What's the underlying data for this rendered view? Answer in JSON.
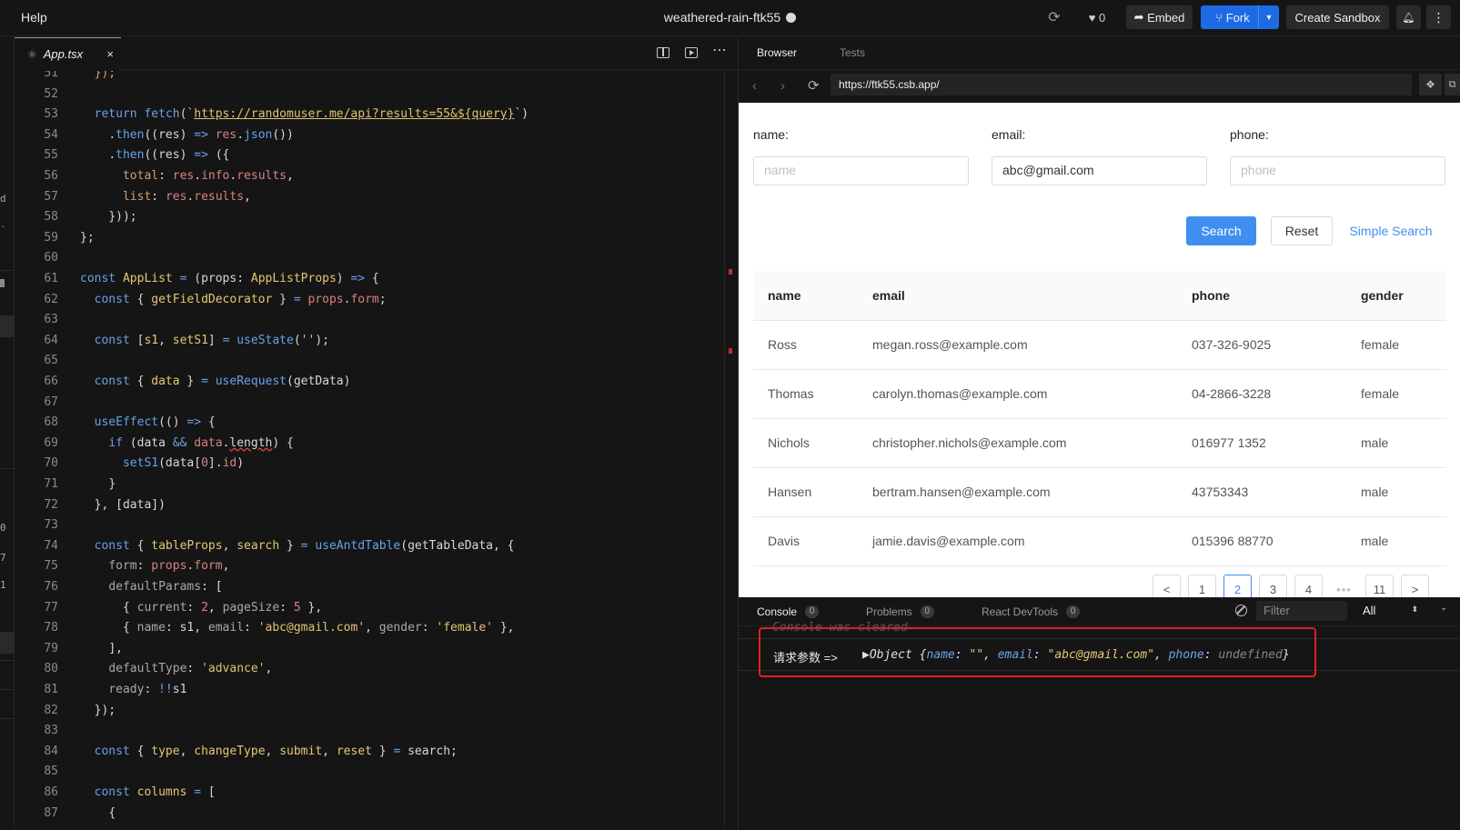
{
  "topbar": {
    "help": "Help",
    "title": "weathered-rain-ftk55",
    "likes": "0",
    "embed": "Embed",
    "fork": "Fork",
    "create_sandbox": "Create Sandbox"
  },
  "left_strip": {
    "fragments": [
      "d",
      "0",
      "7",
      "1"
    ]
  },
  "editor": {
    "tab_name": "App.tsx",
    "close": "×"
  },
  "code_lines": [
    {
      "n": "51",
      "i": 1,
      "t": [
        [
          "p",
          "});"
        ]
      ]
    },
    {
      "n": "52",
      "i": 0,
      "t": []
    },
    {
      "n": "53",
      "i": 1,
      "t": [
        [
          "k",
          "return "
        ],
        [
          "f",
          "fetch"
        ],
        [
          "",
          "("
        ],
        [
          "s",
          "`"
        ],
        [
          "ul",
          "https://randomuser.me/api?results=55&${query}"
        ],
        [
          "s",
          "`"
        ],
        [
          "",
          ")"
        ]
      ]
    },
    {
      "n": "54",
      "i": 2,
      "t": [
        [
          "",
          "."
        ],
        [
          "f",
          "then"
        ],
        [
          "",
          "(("
        ],
        [
          "",
          "res"
        ],
        [
          "",
          ") "
        ],
        [
          "o",
          "=>"
        ],
        [
          "",
          " "
        ],
        [
          "v",
          "res"
        ],
        [
          "",
          "."
        ],
        [
          "f",
          "json"
        ],
        [
          "",
          "())"
        ]
      ]
    },
    {
      "n": "55",
      "i": 2,
      "t": [
        [
          "",
          "."
        ],
        [
          "f",
          "then"
        ],
        [
          "",
          "(("
        ],
        [
          "",
          "res"
        ],
        [
          "",
          ") "
        ],
        [
          "o",
          "=>"
        ],
        [
          "",
          " ({"
        ]
      ]
    },
    {
      "n": "56",
      "i": 3,
      "t": [
        [
          "p",
          "total"
        ],
        [
          "",
          ": "
        ],
        [
          "v",
          "res"
        ],
        [
          "",
          "."
        ],
        [
          "v",
          "info"
        ],
        [
          "",
          "."
        ],
        [
          "v",
          "results"
        ],
        [
          "",
          ","
        ]
      ]
    },
    {
      "n": "57",
      "i": 3,
      "t": [
        [
          "p",
          "list"
        ],
        [
          "",
          ": "
        ],
        [
          "v",
          "res"
        ],
        [
          "",
          "."
        ],
        [
          "v",
          "results"
        ],
        [
          "",
          ","
        ]
      ]
    },
    {
      "n": "58",
      "i": 2,
      "t": [
        [
          "",
          "}));"
        ]
      ]
    },
    {
      "n": "59",
      "i": 0,
      "t": [
        [
          "",
          "};"
        ]
      ]
    },
    {
      "n": "60",
      "i": 0,
      "t": []
    },
    {
      "n": "61",
      "i": 0,
      "t": [
        [
          "k",
          "const "
        ],
        [
          "t",
          "AppList"
        ],
        [
          "o",
          " = "
        ],
        [
          "",
          "("
        ],
        [
          "",
          "props"
        ],
        [
          "",
          ": "
        ],
        [
          "t",
          "AppListProps"
        ],
        [
          "",
          ") "
        ],
        [
          "o",
          "=>"
        ],
        [
          "",
          " {"
        ]
      ]
    },
    {
      "n": "62",
      "i": 1,
      "t": [
        [
          "k",
          "const "
        ],
        [
          "",
          "{ "
        ],
        [
          "t",
          "getFieldDecorator"
        ],
        [
          "",
          " } "
        ],
        [
          "o",
          "="
        ],
        [
          "",
          " "
        ],
        [
          "v",
          "props"
        ],
        [
          "",
          "."
        ],
        [
          "v",
          "form"
        ],
        [
          "",
          ";"
        ]
      ]
    },
    {
      "n": "63",
      "i": 0,
      "t": []
    },
    {
      "n": "64",
      "i": 1,
      "t": [
        [
          "k",
          "const "
        ],
        [
          "",
          "["
        ],
        [
          "t",
          "s1"
        ],
        [
          "",
          ", "
        ],
        [
          "t",
          "setS1"
        ],
        [
          "",
          "] "
        ],
        [
          "o",
          "="
        ],
        [
          "",
          " "
        ],
        [
          "f",
          "useState"
        ],
        [
          "",
          "("
        ],
        [
          "s",
          "''"
        ],
        [
          "",
          ");"
        ]
      ]
    },
    {
      "n": "65",
      "i": 0,
      "t": []
    },
    {
      "n": "66",
      "i": 1,
      "t": [
        [
          "k",
          "const "
        ],
        [
          "",
          "{ "
        ],
        [
          "t",
          "data"
        ],
        [
          "",
          " } "
        ],
        [
          "o",
          "="
        ],
        [
          "",
          " "
        ],
        [
          "f",
          "useRequest"
        ],
        [
          "",
          "(getData)"
        ]
      ]
    },
    {
      "n": "67",
      "i": 0,
      "t": []
    },
    {
      "n": "68",
      "i": 1,
      "t": [
        [
          "f",
          "useEffect"
        ],
        [
          "",
          "(() "
        ],
        [
          "o",
          "=>"
        ],
        [
          "",
          " {"
        ]
      ]
    },
    {
      "n": "69",
      "i": 2,
      "t": [
        [
          "k",
          "if "
        ],
        [
          "",
          "(data "
        ],
        [
          "o",
          "&&"
        ],
        [
          "",
          " "
        ],
        [
          "v",
          "data"
        ],
        [
          "",
          "."
        ],
        [
          "sq",
          "length"
        ],
        [
          "",
          ") {"
        ]
      ]
    },
    {
      "n": "70",
      "i": 3,
      "t": [
        [
          "f",
          "setS1"
        ],
        [
          "",
          "(data["
        ],
        [
          "v",
          "0"
        ],
        [
          "",
          "]."
        ],
        [
          "v",
          "id"
        ],
        [
          "",
          ")"
        ]
      ]
    },
    {
      "n": "71",
      "i": 2,
      "t": [
        [
          "",
          "}"
        ]
      ]
    },
    {
      "n": "72",
      "i": 1,
      "t": [
        [
          "",
          "}, [data])"
        ]
      ]
    },
    {
      "n": "73",
      "i": 0,
      "t": []
    },
    {
      "n": "74",
      "i": 1,
      "t": [
        [
          "k",
          "const "
        ],
        [
          "",
          "{ "
        ],
        [
          "t",
          "tableProps"
        ],
        [
          "",
          ", "
        ],
        [
          "t",
          "search"
        ],
        [
          "",
          " } "
        ],
        [
          "o",
          "="
        ],
        [
          "",
          " "
        ],
        [
          "f",
          "useAntdTable"
        ],
        [
          "",
          "(getTableData, {"
        ]
      ]
    },
    {
      "n": "75",
      "i": 2,
      "t": [
        [
          "dim",
          "form"
        ],
        [
          "",
          ": "
        ],
        [
          "v",
          "props"
        ],
        [
          "",
          "."
        ],
        [
          "v",
          "form"
        ],
        [
          "",
          ","
        ]
      ]
    },
    {
      "n": "76",
      "i": 2,
      "t": [
        [
          "dim",
          "defaultParams"
        ],
        [
          "",
          ": ["
        ]
      ]
    },
    {
      "n": "77",
      "i": 3,
      "t": [
        [
          "",
          "{ "
        ],
        [
          "dim",
          "current"
        ],
        [
          "",
          ": "
        ],
        [
          "v",
          "2"
        ],
        [
          "",
          ", "
        ],
        [
          "dim",
          "pageSize"
        ],
        [
          "",
          ": "
        ],
        [
          "v",
          "5"
        ],
        [
          "",
          " },"
        ]
      ]
    },
    {
      "n": "78",
      "i": 3,
      "t": [
        [
          "",
          "{ "
        ],
        [
          "dim",
          "name"
        ],
        [
          "",
          ": s1, "
        ],
        [
          "dim",
          "email"
        ],
        [
          "",
          ": "
        ],
        [
          "s",
          "'abc@gmail.com'"
        ],
        [
          "",
          ", "
        ],
        [
          "dim",
          "gender"
        ],
        [
          "",
          ": "
        ],
        [
          "s",
          "'female'"
        ],
        [
          "",
          " },"
        ]
      ]
    },
    {
      "n": "79",
      "i": 2,
      "t": [
        [
          "",
          "],"
        ]
      ]
    },
    {
      "n": "80",
      "i": 2,
      "t": [
        [
          "dim",
          "defaultType"
        ],
        [
          "",
          ": "
        ],
        [
          "s",
          "'advance'"
        ],
        [
          "",
          ","
        ]
      ]
    },
    {
      "n": "81",
      "i": 2,
      "t": [
        [
          "dim",
          "ready"
        ],
        [
          "",
          ": "
        ],
        [
          "o",
          "!!"
        ],
        [
          "",
          "s1"
        ]
      ]
    },
    {
      "n": "82",
      "i": 1,
      "t": [
        [
          "",
          "});"
        ]
      ]
    },
    {
      "n": "83",
      "i": 0,
      "t": []
    },
    {
      "n": "84",
      "i": 1,
      "t": [
        [
          "k",
          "const "
        ],
        [
          "",
          "{ "
        ],
        [
          "t",
          "type"
        ],
        [
          "",
          ", "
        ],
        [
          "t",
          "changeType"
        ],
        [
          "",
          ", "
        ],
        [
          "t",
          "submit"
        ],
        [
          "",
          ", "
        ],
        [
          "t",
          "reset"
        ],
        [
          "",
          " } "
        ],
        [
          "o",
          "="
        ],
        [
          "",
          " search;"
        ]
      ]
    },
    {
      "n": "85",
      "i": 0,
      "t": []
    },
    {
      "n": "86",
      "i": 1,
      "t": [
        [
          "k",
          "const "
        ],
        [
          "t",
          "columns"
        ],
        [
          "o",
          " = "
        ],
        [
          "",
          "["
        ]
      ]
    },
    {
      "n": "87",
      "i": 2,
      "t": [
        [
          "",
          "{"
        ]
      ]
    }
  ],
  "browser": {
    "tab_browser": "Browser",
    "tab_tests": "Tests",
    "url": "https://ftk55.csb.app/"
  },
  "form": {
    "name_label": "name:",
    "name_placeholder": "name",
    "email_label": "email:",
    "email_value": "abc@gmail.com",
    "phone_label": "phone:",
    "phone_placeholder": "phone",
    "search": "Search",
    "reset": "Reset",
    "simple_search": "Simple Search"
  },
  "table": {
    "headers": [
      "name",
      "email",
      "phone",
      "gender"
    ],
    "rows": [
      [
        "Ross",
        "megan.ross@example.com",
        "037-326-9025",
        "female"
      ],
      [
        "Thomas",
        "carolyn.thomas@example.com",
        "04-2866-3228",
        "female"
      ],
      [
        "Nichols",
        "christopher.nichols@example.com",
        "016977 1352",
        "male"
      ],
      [
        "Hansen",
        "bertram.hansen@example.com",
        "43753343",
        "male"
      ],
      [
        "Davis",
        "jamie.davis@example.com",
        "015396 88770",
        "male"
      ]
    ]
  },
  "pagination": {
    "prev": "<",
    "pages": [
      "1",
      "2",
      "3",
      "4"
    ],
    "ellipsis": "•••",
    "last": "11",
    "next": ">",
    "current": "2"
  },
  "console": {
    "tab_console": "Console",
    "console_count": "0",
    "tab_problems": "Problems",
    "problems_count": "0",
    "tab_react": "React DevTools",
    "react_count": "0",
    "filter_placeholder": "Filter",
    "level": "All",
    "cleared": "Console was cleared",
    "log_label": "请求参数 =>",
    "log_object_prefix": "▶Object {",
    "log_key_name": "name",
    "log_val_name": "\"\"",
    "log_key_email": "email",
    "log_val_email": "\"abc@gmail.com\"",
    "log_key_phone": "phone",
    "log_val_phone": "undefined",
    "log_object_suffix": "}",
    "prompt": "›"
  },
  "colors": {
    "accent": "#1d6ae5",
    "antd_primary": "#3f8ff0",
    "highlight_border": "#dd2222"
  }
}
